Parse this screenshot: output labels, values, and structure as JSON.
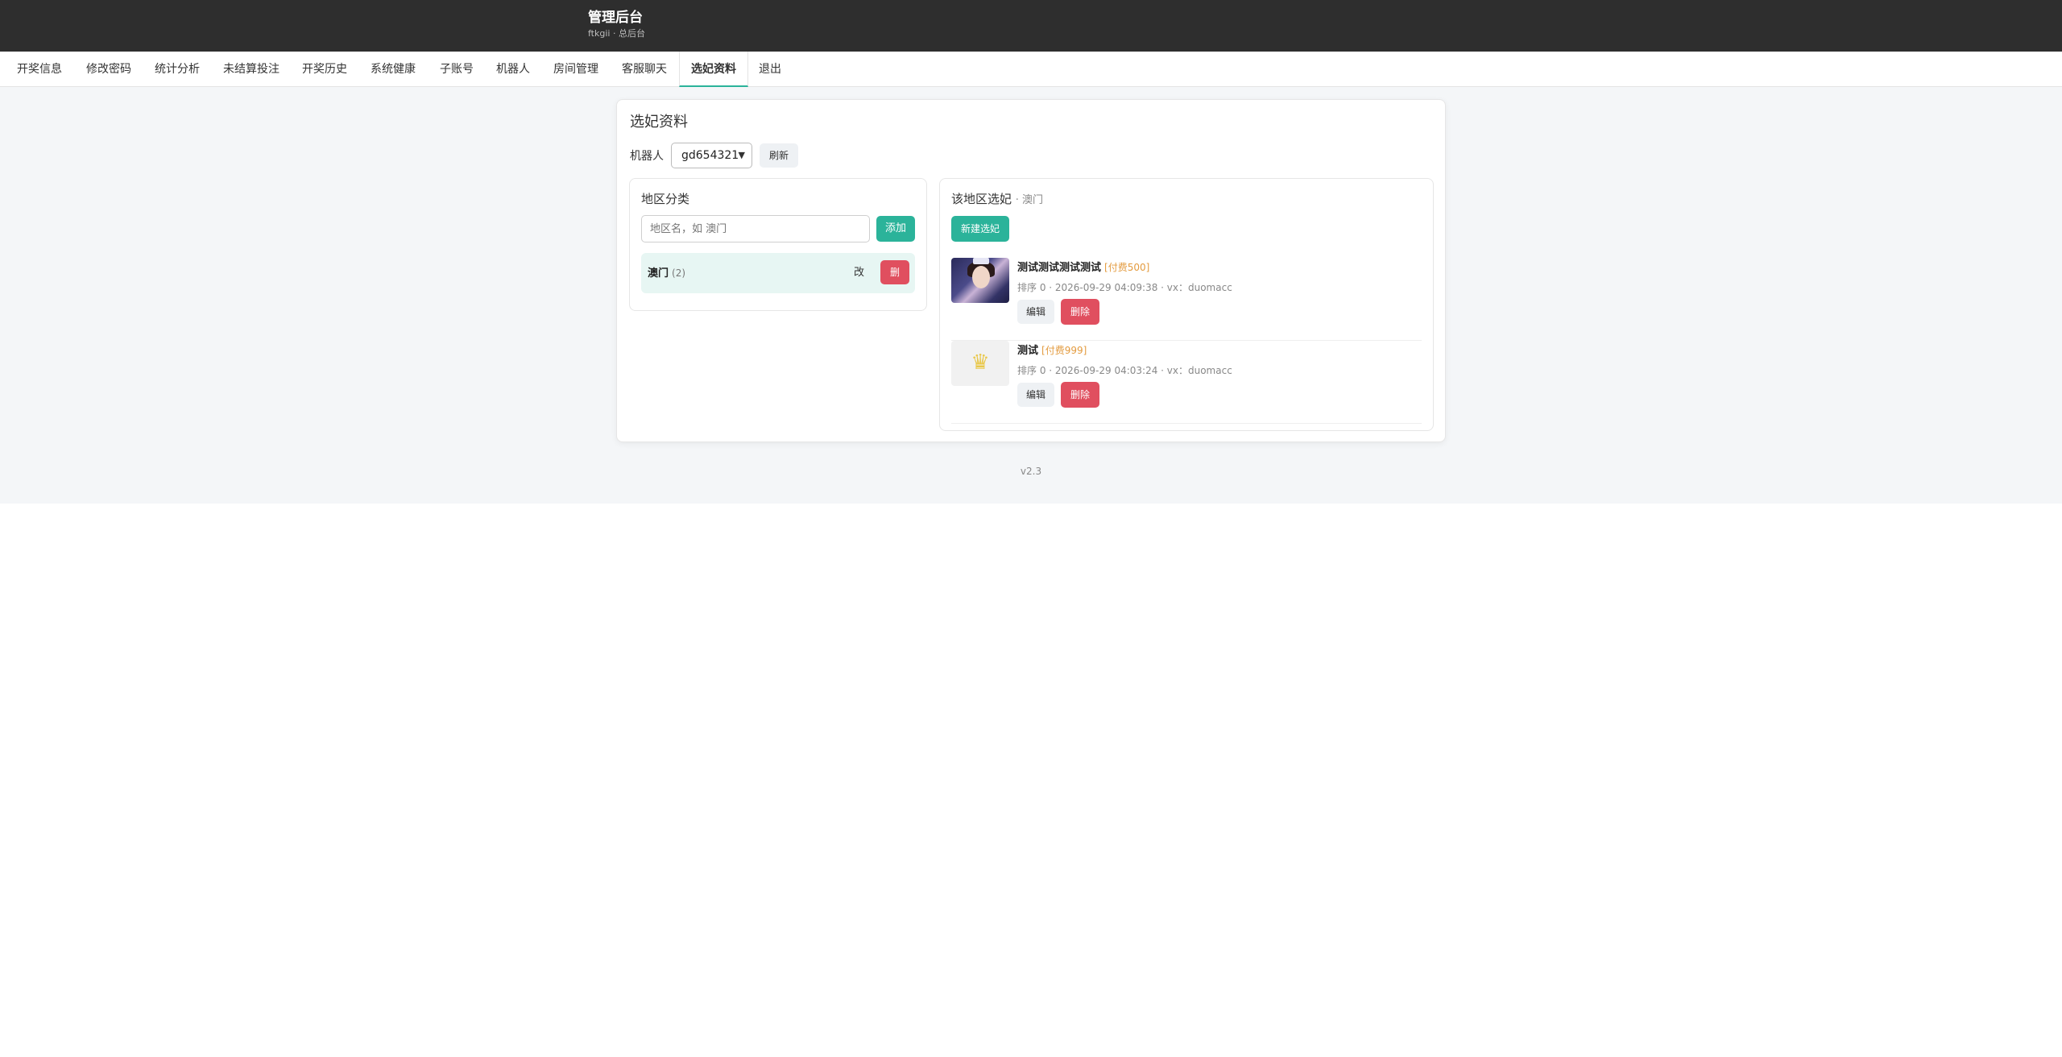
{
  "header": {
    "title": "管理后台",
    "subtitle": "ftkgii · 总后台"
  },
  "nav": {
    "items": [
      {
        "label": "开奖信息"
      },
      {
        "label": "修改密码"
      },
      {
        "label": "统计分析"
      },
      {
        "label": "未结算投注"
      },
      {
        "label": "开奖历史"
      },
      {
        "label": "系统健康"
      },
      {
        "label": "子账号"
      },
      {
        "label": "机器人"
      },
      {
        "label": "房间管理"
      },
      {
        "label": "客服聊天"
      },
      {
        "label": "选妃资料",
        "active": true
      },
      {
        "label": "退出"
      }
    ]
  },
  "page": {
    "title": "选妃资料",
    "robot_label": "机器人",
    "robot_selected": "gd654321",
    "refresh_label": "刷新"
  },
  "regions": {
    "title": "地区分类",
    "input_placeholder": "地区名，如 澳门",
    "add_label": "添加",
    "items": [
      {
        "name": "澳门",
        "count": "(2)",
        "edit_label": "改",
        "delete_label": "删"
      }
    ]
  },
  "entries_panel": {
    "title": "该地区选妃",
    "region_suffix": "· 澳门",
    "new_label": "新建选妃",
    "entries": [
      {
        "name": "测试测试测试测试",
        "tag": "[付费500]",
        "meta": "排序 0 · 2026-09-29 04:09:38 · vx：duomacc",
        "edit_label": "编辑",
        "delete_label": "删除",
        "thumb": "portrait-photo"
      },
      {
        "name": "测试",
        "tag": "[付费999]",
        "meta": "排序 0 · 2026-09-29 04:03:24 · vx：duomacc",
        "edit_label": "编辑",
        "delete_label": "删除",
        "thumb": "crown-logo"
      }
    ]
  },
  "footer": {
    "version": "v2.3"
  },
  "colors": {
    "topbar": "#2e2e2e",
    "accent": "#2bb39a",
    "danger": "#e04f5f",
    "tag": "#e39b3f"
  }
}
